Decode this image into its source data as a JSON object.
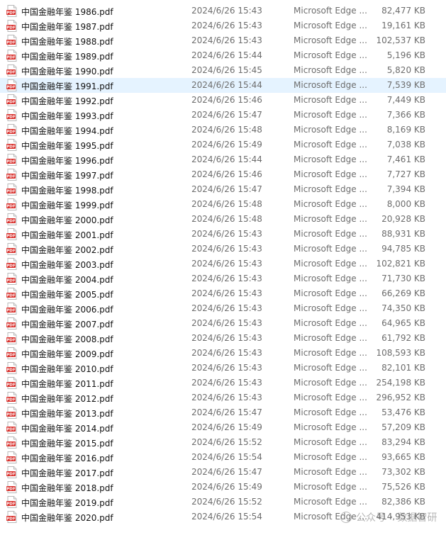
{
  "files": [
    {
      "name": "中国金融年鉴 1986.pdf",
      "date": "2024/6/26 15:43",
      "type": "Microsoft Edge ...",
      "size": "82,477 KB"
    },
    {
      "name": "中国金融年鉴 1987.pdf",
      "date": "2024/6/26 15:43",
      "type": "Microsoft Edge ...",
      "size": "19,161 KB"
    },
    {
      "name": "中国金融年鉴 1988.pdf",
      "date": "2024/6/26 15:43",
      "type": "Microsoft Edge ...",
      "size": "102,537 KB"
    },
    {
      "name": "中国金融年鉴 1989.pdf",
      "date": "2024/6/26 15:44",
      "type": "Microsoft Edge ...",
      "size": "5,196 KB"
    },
    {
      "name": "中国金融年鉴 1990.pdf",
      "date": "2024/6/26 15:45",
      "type": "Microsoft Edge ...",
      "size": "5,820 KB"
    },
    {
      "name": "中国金融年鉴 1991.pdf",
      "date": "2024/6/26 15:44",
      "type": "Microsoft Edge ...",
      "size": "7,539 KB"
    },
    {
      "name": "中国金融年鉴 1992.pdf",
      "date": "2024/6/26 15:46",
      "type": "Microsoft Edge ...",
      "size": "7,449 KB"
    },
    {
      "name": "中国金融年鉴 1993.pdf",
      "date": "2024/6/26 15:47",
      "type": "Microsoft Edge ...",
      "size": "7,366 KB"
    },
    {
      "name": "中国金融年鉴 1994.pdf",
      "date": "2024/6/26 15:48",
      "type": "Microsoft Edge ...",
      "size": "8,169 KB"
    },
    {
      "name": "中国金融年鉴 1995.pdf",
      "date": "2024/6/26 15:49",
      "type": "Microsoft Edge ...",
      "size": "7,038 KB"
    },
    {
      "name": "中国金融年鉴 1996.pdf",
      "date": "2024/6/26 15:44",
      "type": "Microsoft Edge ...",
      "size": "7,461 KB"
    },
    {
      "name": "中国金融年鉴 1997.pdf",
      "date": "2024/6/26 15:46",
      "type": "Microsoft Edge ...",
      "size": "7,727 KB"
    },
    {
      "name": "中国金融年鉴 1998.pdf",
      "date": "2024/6/26 15:47",
      "type": "Microsoft Edge ...",
      "size": "7,394 KB"
    },
    {
      "name": "中国金融年鉴 1999.pdf",
      "date": "2024/6/26 15:48",
      "type": "Microsoft Edge ...",
      "size": "8,000 KB"
    },
    {
      "name": "中国金融年鉴 2000.pdf",
      "date": "2024/6/26 15:48",
      "type": "Microsoft Edge ...",
      "size": "20,928 KB"
    },
    {
      "name": "中国金融年鉴 2001.pdf",
      "date": "2024/6/26 15:43",
      "type": "Microsoft Edge ...",
      "size": "88,931 KB"
    },
    {
      "name": "中国金融年鉴 2002.pdf",
      "date": "2024/6/26 15:43",
      "type": "Microsoft Edge ...",
      "size": "94,785 KB"
    },
    {
      "name": "中国金融年鉴 2003.pdf",
      "date": "2024/6/26 15:43",
      "type": "Microsoft Edge ...",
      "size": "102,821 KB"
    },
    {
      "name": "中国金融年鉴 2004.pdf",
      "date": "2024/6/26 15:43",
      "type": "Microsoft Edge ...",
      "size": "71,730 KB"
    },
    {
      "name": "中国金融年鉴 2005.pdf",
      "date": "2024/6/26 15:43",
      "type": "Microsoft Edge ...",
      "size": "66,269 KB"
    },
    {
      "name": "中国金融年鉴 2006.pdf",
      "date": "2024/6/26 15:43",
      "type": "Microsoft Edge ...",
      "size": "74,350 KB"
    },
    {
      "name": "中国金融年鉴 2007.pdf",
      "date": "2024/6/26 15:43",
      "type": "Microsoft Edge ...",
      "size": "64,965 KB"
    },
    {
      "name": "中国金融年鉴 2008.pdf",
      "date": "2024/6/26 15:43",
      "type": "Microsoft Edge ...",
      "size": "61,792 KB"
    },
    {
      "name": "中国金融年鉴 2009.pdf",
      "date": "2024/6/26 15:43",
      "type": "Microsoft Edge ...",
      "size": "108,593 KB"
    },
    {
      "name": "中国金融年鉴 2010.pdf",
      "date": "2024/6/26 15:43",
      "type": "Microsoft Edge ...",
      "size": "82,101 KB"
    },
    {
      "name": "中国金融年鉴 2011.pdf",
      "date": "2024/6/26 15:43",
      "type": "Microsoft Edge ...",
      "size": "254,198 KB"
    },
    {
      "name": "中国金融年鉴 2012.pdf",
      "date": "2024/6/26 15:43",
      "type": "Microsoft Edge ...",
      "size": "296,952 KB"
    },
    {
      "name": "中国金融年鉴 2013.pdf",
      "date": "2024/6/26 15:47",
      "type": "Microsoft Edge ...",
      "size": "53,476 KB"
    },
    {
      "name": "中国金融年鉴 2014.pdf",
      "date": "2024/6/26 15:49",
      "type": "Microsoft Edge ...",
      "size": "57,209 KB"
    },
    {
      "name": "中国金融年鉴 2015.pdf",
      "date": "2024/6/26 15:52",
      "type": "Microsoft Edge ...",
      "size": "83,294 KB"
    },
    {
      "name": "中国金融年鉴 2016.pdf",
      "date": "2024/6/26 15:54",
      "type": "Microsoft Edge ...",
      "size": "93,665 KB"
    },
    {
      "name": "中国金融年鉴 2017.pdf",
      "date": "2024/6/26 15:47",
      "type": "Microsoft Edge ...",
      "size": "73,302 KB"
    },
    {
      "name": "中国金融年鉴 2018.pdf",
      "date": "2024/6/26 15:49",
      "type": "Microsoft Edge ...",
      "size": "75,526 KB"
    },
    {
      "name": "中国金融年鉴 2019.pdf",
      "date": "2024/6/26 15:52",
      "type": "Microsoft Edge ...",
      "size": "82,386 KB"
    },
    {
      "name": "中国金融年鉴 2020.pdf",
      "date": "2024/6/26 15:54",
      "type": "Microsoft Edge ...",
      "size": "414,953 KB"
    }
  ],
  "selected_index": 5,
  "icon": {
    "name": "pdf-file-icon",
    "label": "PDF",
    "color": "#d9302c"
  },
  "watermark": {
    "prefix": "公众号",
    "separator": "·",
    "text": "数据智研"
  },
  "colors": {
    "selection": "#e5f3ff",
    "name_text": "#111111",
    "meta_text": "#6d6d6d"
  }
}
